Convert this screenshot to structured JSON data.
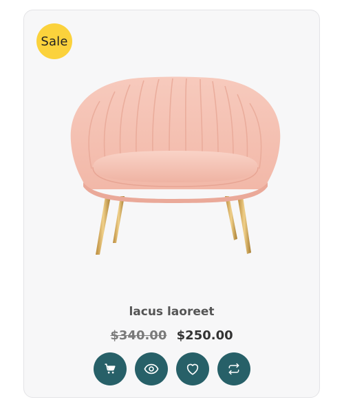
{
  "product": {
    "badge": "Sale",
    "title": "lacus laoreet",
    "old_price": "$340.00",
    "new_price": "$250.00",
    "image_alt": "Pink velvet tufted armchair with gold legs"
  },
  "actions": [
    {
      "name": "add-to-cart-button",
      "icon": "cart-icon"
    },
    {
      "name": "quick-view-button",
      "icon": "eye-icon"
    },
    {
      "name": "wishlist-button",
      "icon": "heart-icon"
    },
    {
      "name": "compare-button",
      "icon": "compare-arrows-icon"
    }
  ],
  "colors": {
    "badge": "#fbd23c",
    "action_button": "#276068",
    "card_background": "#f7f7f8"
  }
}
